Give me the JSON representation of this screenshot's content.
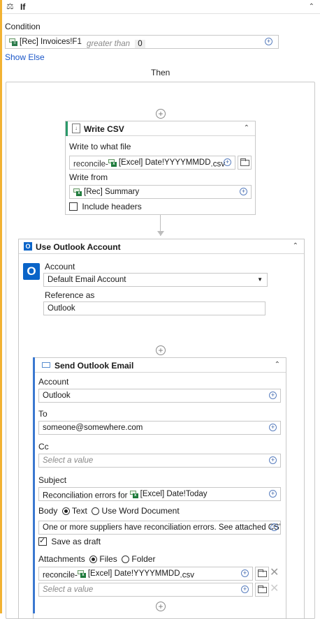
{
  "if_block": {
    "title": "If",
    "condition_label": "Condition",
    "condition": {
      "variable": "[Rec] Invoices!F1",
      "operator": "greater than",
      "value": "0"
    },
    "show_else": "Show Else",
    "then_label": "Then"
  },
  "write_csv": {
    "title": "Write CSV",
    "file_label": "Write to what file",
    "file_prefix": "reconcile-",
    "file_variable": "[Excel] Date!YYYYMMDD",
    "file_suffix": ".csv",
    "from_label": "Write from",
    "from_value": "[Rec] Summary",
    "include_headers_label": "Include headers",
    "include_headers_checked": false
  },
  "outlook_account": {
    "title": "Use Outlook Account",
    "account_label": "Account",
    "account_value": "Default Email Account",
    "reference_label": "Reference as",
    "reference_value": "Outlook"
  },
  "send_email": {
    "title": "Send Outlook Email",
    "account_label": "Account",
    "account_value": "Outlook",
    "to_label": "To",
    "to_value": "someone@somewhere.com",
    "cc_label": "Cc",
    "cc_placeholder": "Select a value",
    "subject_label": "Subject",
    "subject_prefix": "Reconciliation errors for",
    "subject_variable": "[Excel] Date!Today",
    "body_label": "Body",
    "body_option_text": "Text",
    "body_option_word": "Use Word Document",
    "body_value": "One or more suppliers have reconciliation errors.  See attached CSV I…",
    "save_draft_label": "Save as draft",
    "save_draft_checked": true,
    "attachments_label": "Attachments",
    "attach_option_files": "Files",
    "attach_option_folder": "Folder",
    "attachment1_prefix": "reconcile-",
    "attachment1_variable": "[Excel] Date!YYYYMMDD",
    "attachment1_suffix": ".csv",
    "attachment2_placeholder": "Select a value"
  },
  "colors": {
    "if_accent": "#f2b233",
    "outlook_blue": "#0a64c8",
    "link_blue": "#1a56c8",
    "write_csv_accent": "#2a9a6a"
  }
}
